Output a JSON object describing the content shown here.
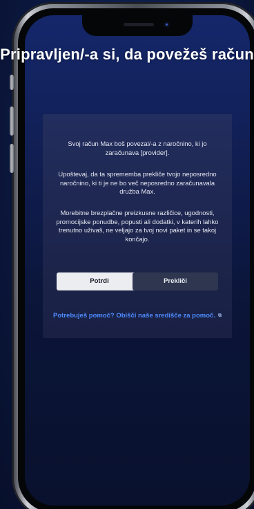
{
  "dialog": {
    "title": "Pripravljen/-a si, da povežeš račun",
    "paragraph_1": "Svoj račun Max boš povezal/-a z naročnino, ki jo zaračunava [provider].",
    "paragraph_2": "Upoštevaj, da ta sprememba prekliče tvojo neposredno naročnino, ki ti je ne bo več neposredno zaračunavala družba Max.",
    "paragraph_3": "Morebitne brezplačne preizkusne različice, ugodnosti, promocijske ponudbe, popusti ali dodatki, v katerih lahko trenutno uživaš, ne veljajo za tvoj novi paket in se takoj končajo.",
    "confirm_label": "Potrdi",
    "cancel_label": "Prekliči",
    "help_link": "Potrebuješ pomoč? Obišči naše središče za pomoč.",
    "help_link_icon": "external-link-icon"
  },
  "colors": {
    "background": "#0b1840",
    "link": "#4d8cff",
    "confirm_button": "#ecedf1",
    "cancel_button": "#2f3650"
  }
}
